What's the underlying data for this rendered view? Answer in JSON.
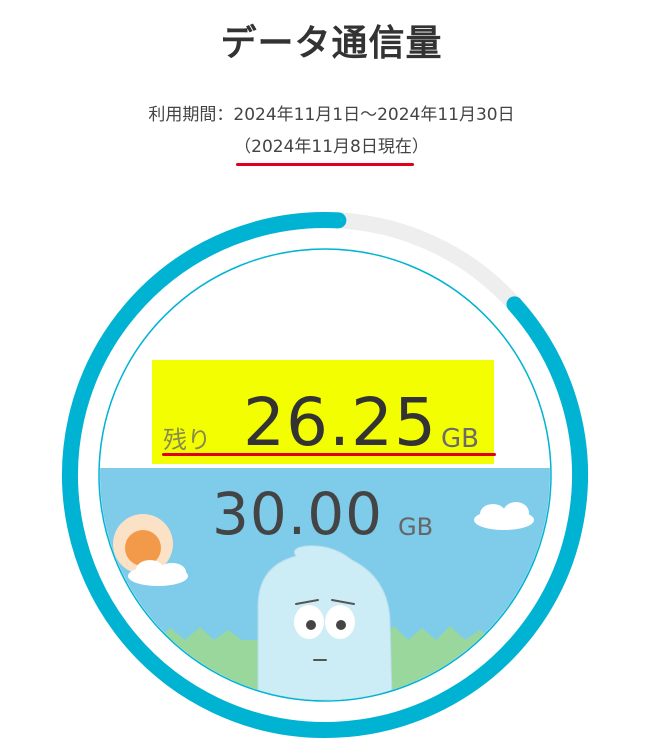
{
  "header": {
    "title": "データ通信量",
    "period": "利用期間：2024年11月1日〜2024年11月30日",
    "as_of": "（2024年11月8日現在）"
  },
  "usage": {
    "remaining_label": "残り",
    "remaining_value": "26.25",
    "remaining_unit": "GB",
    "total_value": "30.00",
    "total_unit": "GB",
    "remaining_fraction": 0.875
  },
  "colors": {
    "ring": "#00b3d3",
    "ring_track": "#eeeeee",
    "sky": "#7ecbea",
    "highlight": "#f3ff00",
    "underline": "#e0001a",
    "grass": "#9ad79c",
    "character": "#ccecf6",
    "sun": "#f39a4a"
  },
  "icons": {
    "sun": "sun-icon",
    "clouds": "cloud-icon",
    "mascot": "mascot-character"
  }
}
